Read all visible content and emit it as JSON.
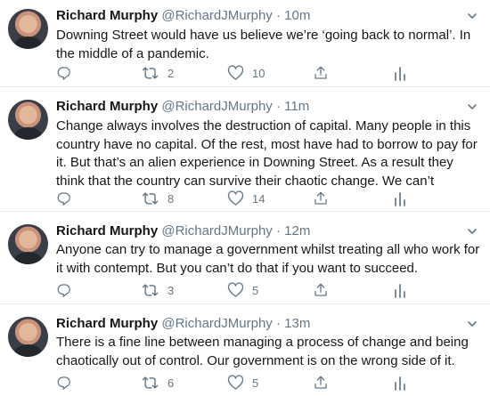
{
  "tweets": [
    {
      "name": "Richard Murphy",
      "handle": "@RichardJMurphy",
      "separator": "·",
      "time": "10m",
      "text": "Downing Street would have us believe we’re ‘going back to normal’. In the middle of a pandemic.",
      "retweets": "2",
      "likes": "10"
    },
    {
      "name": "Richard Murphy",
      "handle": "@RichardJMurphy",
      "separator": "·",
      "time": "11m",
      "text": "Change always involves the destruction of capital. Many people in this country have no capital. Of the rest, most have had to borrow to pay for it. But that’s an alien experience in Downing Street. As a result they think that the country can survive their chaotic change. We can’t",
      "retweets": "8",
      "likes": "14"
    },
    {
      "name": "Richard Murphy",
      "handle": "@RichardJMurphy",
      "separator": "·",
      "time": "12m",
      "text": "Anyone can try to manage a government whilst treating all who work for it with contempt. But you can’t do that if you want to succeed.",
      "retweets": "3",
      "likes": "5"
    },
    {
      "name": "Richard Murphy",
      "handle": "@RichardJMurphy",
      "separator": "·",
      "time": "13m",
      "text": "There is a fine line between managing a process of change and being chaotically out of control. Our government is on the wrong side of it.",
      "retweets": "6",
      "likes": "5"
    }
  ],
  "icons": {
    "reply": "reply-icon",
    "retweet": "retweet-icon",
    "like": "like-icon",
    "share": "share-icon",
    "analytics": "analytics-icon",
    "caret": "chevron-down-icon"
  },
  "colors": {
    "name": "#14171a",
    "secondary": "#657786",
    "divider": "#e6ecf0"
  }
}
